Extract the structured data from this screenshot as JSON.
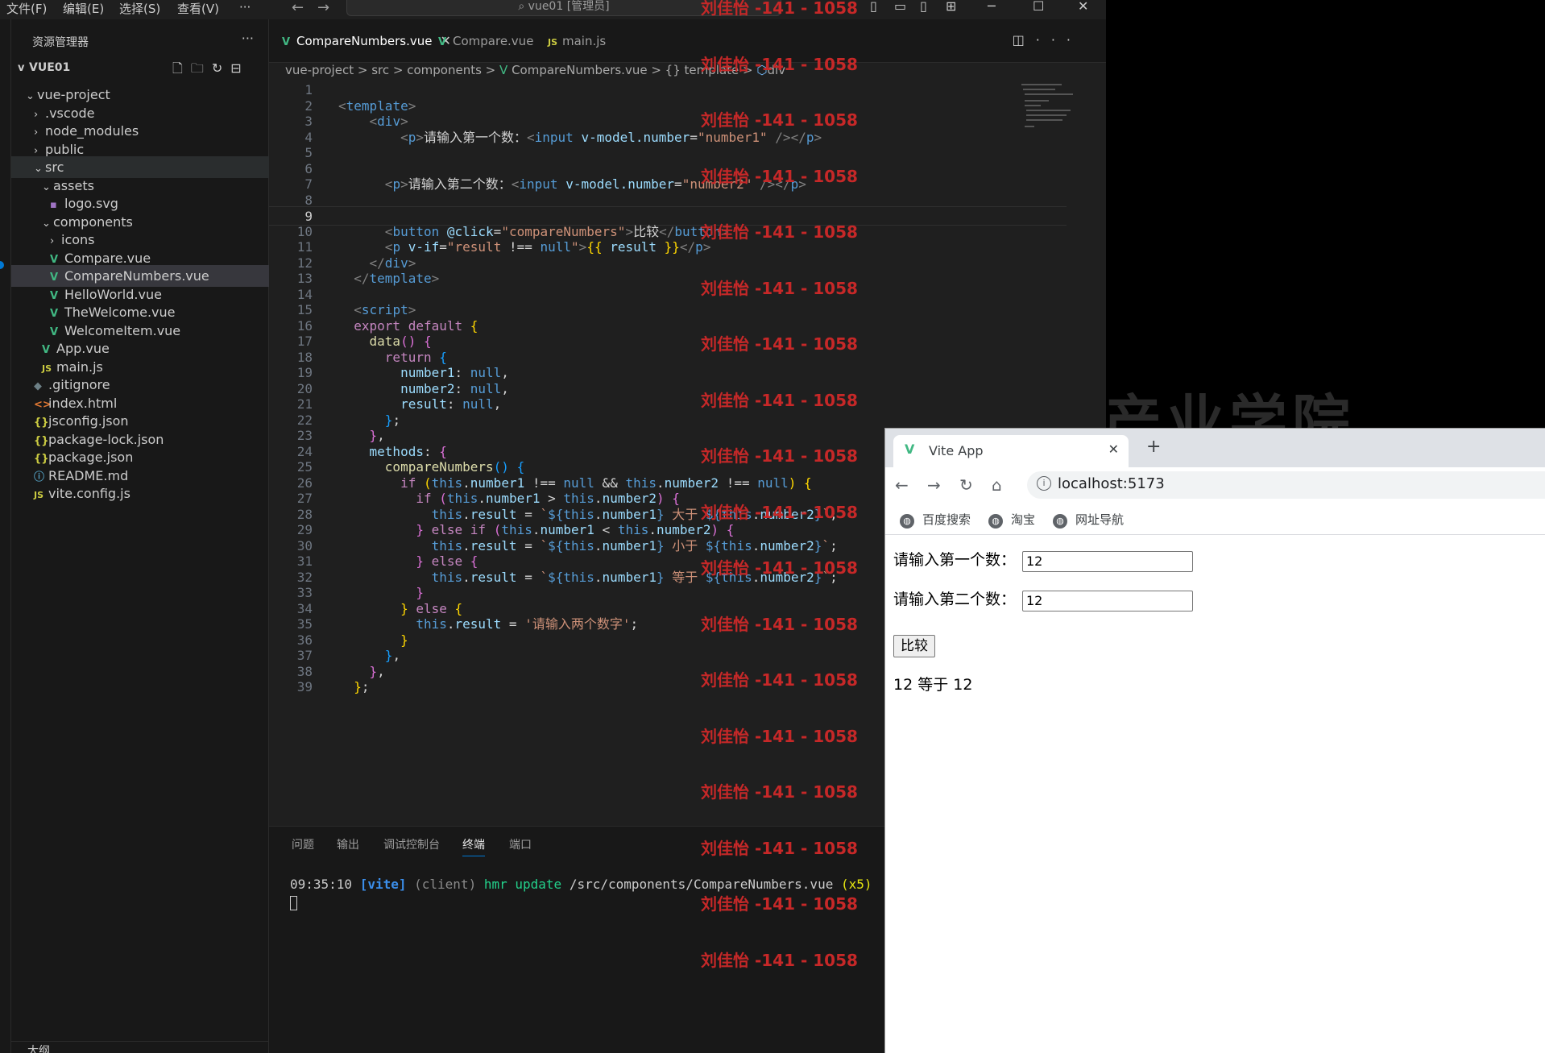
{
  "titlebar": {
    "menus": [
      "文件(F)",
      "编辑(E)",
      "选择(S)",
      "查看(V)",
      "···"
    ],
    "command_center": "vue01 [管理员]"
  },
  "sidebar": {
    "title": "资源管理器",
    "project": "VUE01",
    "bottom_label": "大纲",
    "tree": [
      {
        "label": "vue-project",
        "indent": 1,
        "chev": "v",
        "icon": ""
      },
      {
        "label": ".vscode",
        "indent": 2,
        "chev": ">",
        "icon": ""
      },
      {
        "label": "node_modules",
        "indent": 2,
        "chev": ">",
        "icon": ""
      },
      {
        "label": "public",
        "indent": 2,
        "chev": ">",
        "icon": ""
      },
      {
        "label": "src",
        "indent": 2,
        "chev": "v",
        "icon": "",
        "hover": true
      },
      {
        "label": "assets",
        "indent": 3,
        "chev": "v",
        "icon": ""
      },
      {
        "label": "logo.svg",
        "indent": 4,
        "chev": "",
        "icon": "svg"
      },
      {
        "label": "components",
        "indent": 3,
        "chev": "v",
        "icon": ""
      },
      {
        "label": "icons",
        "indent": 4,
        "chev": ">",
        "icon": ""
      },
      {
        "label": "Compare.vue",
        "indent": 4,
        "chev": "",
        "icon": "vue"
      },
      {
        "label": "CompareNumbers.vue",
        "indent": 4,
        "chev": "",
        "icon": "vue",
        "active": true
      },
      {
        "label": "HelloWorld.vue",
        "indent": 4,
        "chev": "",
        "icon": "vue"
      },
      {
        "label": "TheWelcome.vue",
        "indent": 4,
        "chev": "",
        "icon": "vue"
      },
      {
        "label": "WelcomeItem.vue",
        "indent": 4,
        "chev": "",
        "icon": "vue"
      },
      {
        "label": "App.vue",
        "indent": 3,
        "chev": "",
        "icon": "vue"
      },
      {
        "label": "main.js",
        "indent": 3,
        "chev": "",
        "icon": "js"
      },
      {
        "label": ".gitignore",
        "indent": 2,
        "chev": "",
        "icon": "git"
      },
      {
        "label": "index.html",
        "indent": 2,
        "chev": "",
        "icon": "html"
      },
      {
        "label": "jsconfig.json",
        "indent": 2,
        "chev": "",
        "icon": "json"
      },
      {
        "label": "package-lock.json",
        "indent": 2,
        "chev": "",
        "icon": "json"
      },
      {
        "label": "package.json",
        "indent": 2,
        "chev": "",
        "icon": "json"
      },
      {
        "label": "README.md",
        "indent": 2,
        "chev": "",
        "icon": "info"
      },
      {
        "label": "vite.config.js",
        "indent": 2,
        "chev": "",
        "icon": "js"
      }
    ]
  },
  "editor": {
    "tabs": [
      {
        "label": "CompareNumbers.vue",
        "icon": "vue",
        "active": true
      },
      {
        "label": "Compare.vue",
        "icon": "vue",
        "active": false
      },
      {
        "label": "main.js",
        "icon": "js",
        "active": false
      }
    ],
    "breadcrumb": [
      "vue-project",
      "src",
      "components",
      "CompareNumbers.vue",
      "{} template",
      "div"
    ],
    "current_line": 9,
    "lines": [
      [],
      [
        [
          "c-brk",
          "<"
        ],
        [
          "c-tag",
          "template"
        ],
        [
          "c-brk",
          ">"
        ]
      ],
      [
        [
          "c-txt",
          "    "
        ],
        [
          "c-brk",
          "<"
        ],
        [
          "c-tag",
          "div"
        ],
        [
          "c-brk",
          ">"
        ]
      ],
      [
        [
          "c-txt",
          "        "
        ],
        [
          "c-brk",
          "<"
        ],
        [
          "c-tag",
          "p"
        ],
        [
          "c-brk",
          ">"
        ],
        [
          "c-txt",
          "请输入第一个数："
        ],
        [
          "c-brk",
          "<"
        ],
        [
          "c-tag",
          "input"
        ],
        [
          "c-txt",
          " "
        ],
        [
          "c-attr",
          "v-model.number"
        ],
        [
          "c-txt",
          "="
        ],
        [
          "c-str",
          "\"number1\""
        ],
        [
          "c-txt",
          " "
        ],
        [
          "c-brk",
          "/></"
        ],
        [
          "c-tag",
          "p"
        ],
        [
          "c-brk",
          ">"
        ]
      ],
      [],
      [],
      [
        [
          "c-txt",
          "      "
        ],
        [
          "c-brk",
          "<"
        ],
        [
          "c-tag",
          "p"
        ],
        [
          "c-brk",
          ">"
        ],
        [
          "c-txt",
          "请输入第二个数："
        ],
        [
          "c-brk",
          "<"
        ],
        [
          "c-tag",
          "input"
        ],
        [
          "c-txt",
          " "
        ],
        [
          "c-attr",
          "v-model.number"
        ],
        [
          "c-txt",
          "="
        ],
        [
          "c-str",
          "\"number2\""
        ],
        [
          "c-txt",
          " "
        ],
        [
          "c-brk",
          "/></"
        ],
        [
          "c-tag",
          "p"
        ],
        [
          "c-brk",
          ">"
        ]
      ],
      [],
      [],
      [
        [
          "c-txt",
          "      "
        ],
        [
          "c-brk",
          "<"
        ],
        [
          "c-tag",
          "button"
        ],
        [
          "c-txt",
          " "
        ],
        [
          "c-attr",
          "@click"
        ],
        [
          "c-txt",
          "="
        ],
        [
          "c-str",
          "\"compareNumbers\""
        ],
        [
          "c-brk",
          ">"
        ],
        [
          "c-txt",
          "比较"
        ],
        [
          "c-brk",
          "</"
        ],
        [
          "c-tag",
          "button"
        ],
        [
          "c-brk",
          ">"
        ]
      ],
      [
        [
          "c-txt",
          "      "
        ],
        [
          "c-brk",
          "<"
        ],
        [
          "c-tag",
          "p"
        ],
        [
          "c-txt",
          " "
        ],
        [
          "c-attr",
          "v-if"
        ],
        [
          "c-txt",
          "="
        ],
        [
          "c-str",
          "\"result "
        ],
        [
          "c-txt",
          "!=="
        ],
        [
          "c-str",
          " "
        ],
        [
          "c-this",
          "null"
        ],
        [
          "c-str",
          "\""
        ],
        [
          "c-brk",
          ">"
        ],
        [
          "c-b1",
          "{{"
        ],
        [
          "c-var",
          " result "
        ],
        [
          "c-b1",
          "}}"
        ],
        [
          "c-brk",
          "</"
        ],
        [
          "c-tag",
          "p"
        ],
        [
          "c-brk",
          ">"
        ]
      ],
      [
        [
          "c-txt",
          "    "
        ],
        [
          "c-brk",
          "</"
        ],
        [
          "c-tag",
          "div"
        ],
        [
          "c-brk",
          ">"
        ]
      ],
      [
        [
          "c-txt",
          "  "
        ],
        [
          "c-brk",
          "</"
        ],
        [
          "c-tag",
          "template"
        ],
        [
          "c-brk",
          ">"
        ]
      ],
      [],
      [
        [
          "c-txt",
          "  "
        ],
        [
          "c-brk",
          "<"
        ],
        [
          "c-tag",
          "script"
        ],
        [
          "c-brk",
          ">"
        ]
      ],
      [
        [
          "c-txt",
          "  "
        ],
        [
          "c-kw",
          "export default"
        ],
        [
          "c-txt",
          " "
        ],
        [
          "c-b1",
          "{"
        ]
      ],
      [
        [
          "c-txt",
          "    "
        ],
        [
          "c-fn",
          "data"
        ],
        [
          "c-b2",
          "()"
        ],
        [
          "c-txt",
          " "
        ],
        [
          "c-b2",
          "{"
        ]
      ],
      [
        [
          "c-txt",
          "      "
        ],
        [
          "c-kw",
          "return"
        ],
        [
          "c-txt",
          " "
        ],
        [
          "c-b3",
          "{"
        ]
      ],
      [
        [
          "c-txt",
          "        "
        ],
        [
          "c-var",
          "number1"
        ],
        [
          "c-txt",
          ": "
        ],
        [
          "c-this",
          "null"
        ],
        [
          "c-txt",
          ","
        ]
      ],
      [
        [
          "c-txt",
          "        "
        ],
        [
          "c-var",
          "number2"
        ],
        [
          "c-txt",
          ": "
        ],
        [
          "c-this",
          "null"
        ],
        [
          "c-txt",
          ","
        ]
      ],
      [
        [
          "c-txt",
          "        "
        ],
        [
          "c-var",
          "result"
        ],
        [
          "c-txt",
          ": "
        ],
        [
          "c-this",
          "null"
        ],
        [
          "c-txt",
          ","
        ]
      ],
      [
        [
          "c-txt",
          "      "
        ],
        [
          "c-b3",
          "}"
        ],
        [
          "c-txt",
          ";"
        ]
      ],
      [
        [
          "c-txt",
          "    "
        ],
        [
          "c-b2",
          "}"
        ],
        [
          "c-txt",
          ","
        ]
      ],
      [
        [
          "c-txt",
          "    "
        ],
        [
          "c-var",
          "methods"
        ],
        [
          "c-txt",
          ": "
        ],
        [
          "c-b2",
          "{"
        ]
      ],
      [
        [
          "c-txt",
          "      "
        ],
        [
          "c-fn",
          "compareNumbers"
        ],
        [
          "c-b3",
          "()"
        ],
        [
          "c-txt",
          " "
        ],
        [
          "c-b3",
          "{"
        ]
      ],
      [
        [
          "c-txt",
          "        "
        ],
        [
          "c-kw",
          "if"
        ],
        [
          "c-txt",
          " "
        ],
        [
          "c-b1",
          "("
        ],
        [
          "c-this",
          "this"
        ],
        [
          "c-txt",
          "."
        ],
        [
          "c-var",
          "number1"
        ],
        [
          "c-txt",
          " !== "
        ],
        [
          "c-this",
          "null"
        ],
        [
          "c-txt",
          " && "
        ],
        [
          "c-this",
          "this"
        ],
        [
          "c-txt",
          "."
        ],
        [
          "c-var",
          "number2"
        ],
        [
          "c-txt",
          " !== "
        ],
        [
          "c-this",
          "null"
        ],
        [
          "c-b1",
          ")"
        ],
        [
          "c-txt",
          " "
        ],
        [
          "c-b1",
          "{"
        ]
      ],
      [
        [
          "c-txt",
          "          "
        ],
        [
          "c-kw",
          "if"
        ],
        [
          "c-txt",
          " "
        ],
        [
          "c-b2",
          "("
        ],
        [
          "c-this",
          "this"
        ],
        [
          "c-txt",
          "."
        ],
        [
          "c-var",
          "number1"
        ],
        [
          "c-txt",
          " > "
        ],
        [
          "c-this",
          "this"
        ],
        [
          "c-txt",
          "."
        ],
        [
          "c-var",
          "number2"
        ],
        [
          "c-b2",
          ")"
        ],
        [
          "c-txt",
          " "
        ],
        [
          "c-b2",
          "{"
        ]
      ],
      [
        [
          "c-txt",
          "            "
        ],
        [
          "c-this",
          "this"
        ],
        [
          "c-txt",
          "."
        ],
        [
          "c-var",
          "result"
        ],
        [
          "c-txt",
          " = "
        ],
        [
          "c-str",
          "`"
        ],
        [
          "c-this",
          "${"
        ],
        [
          "c-this",
          "this"
        ],
        [
          "c-txt",
          "."
        ],
        [
          "c-var",
          "number1"
        ],
        [
          "c-this",
          "}"
        ],
        [
          "c-str",
          " 大于 "
        ],
        [
          "c-this",
          "${"
        ],
        [
          "c-this",
          "this"
        ],
        [
          "c-txt",
          "."
        ],
        [
          "c-var",
          "number2"
        ],
        [
          "c-this",
          "}"
        ],
        [
          "c-str",
          "`"
        ],
        [
          "c-txt",
          ";"
        ]
      ],
      [
        [
          "c-txt",
          "          "
        ],
        [
          "c-b2",
          "}"
        ],
        [
          "c-txt",
          " "
        ],
        [
          "c-kw",
          "else if"
        ],
        [
          "c-txt",
          " "
        ],
        [
          "c-b2",
          "("
        ],
        [
          "c-this",
          "this"
        ],
        [
          "c-txt",
          "."
        ],
        [
          "c-var",
          "number1"
        ],
        [
          "c-txt",
          " < "
        ],
        [
          "c-this",
          "this"
        ],
        [
          "c-txt",
          "."
        ],
        [
          "c-var",
          "number2"
        ],
        [
          "c-b2",
          ")"
        ],
        [
          "c-txt",
          " "
        ],
        [
          "c-b2",
          "{"
        ]
      ],
      [
        [
          "c-txt",
          "            "
        ],
        [
          "c-this",
          "this"
        ],
        [
          "c-txt",
          "."
        ],
        [
          "c-var",
          "result"
        ],
        [
          "c-txt",
          " = "
        ],
        [
          "c-str",
          "`"
        ],
        [
          "c-this",
          "${"
        ],
        [
          "c-this",
          "this"
        ],
        [
          "c-txt",
          "."
        ],
        [
          "c-var",
          "number1"
        ],
        [
          "c-this",
          "}"
        ],
        [
          "c-str",
          " 小于 "
        ],
        [
          "c-this",
          "${"
        ],
        [
          "c-this",
          "this"
        ],
        [
          "c-txt",
          "."
        ],
        [
          "c-var",
          "number2"
        ],
        [
          "c-this",
          "}"
        ],
        [
          "c-str",
          "`"
        ],
        [
          "c-txt",
          ";"
        ]
      ],
      [
        [
          "c-txt",
          "          "
        ],
        [
          "c-b2",
          "}"
        ],
        [
          "c-txt",
          " "
        ],
        [
          "c-kw",
          "else"
        ],
        [
          "c-txt",
          " "
        ],
        [
          "c-b2",
          "{"
        ]
      ],
      [
        [
          "c-txt",
          "            "
        ],
        [
          "c-this",
          "this"
        ],
        [
          "c-txt",
          "."
        ],
        [
          "c-var",
          "result"
        ],
        [
          "c-txt",
          " = "
        ],
        [
          "c-str",
          "`"
        ],
        [
          "c-this",
          "${"
        ],
        [
          "c-this",
          "this"
        ],
        [
          "c-txt",
          "."
        ],
        [
          "c-var",
          "number1"
        ],
        [
          "c-this",
          "}"
        ],
        [
          "c-str",
          " 等于 "
        ],
        [
          "c-this",
          "${"
        ],
        [
          "c-this",
          "this"
        ],
        [
          "c-txt",
          "."
        ],
        [
          "c-var",
          "number2"
        ],
        [
          "c-this",
          "}"
        ],
        [
          "c-str",
          "`"
        ],
        [
          "c-txt",
          ";"
        ]
      ],
      [
        [
          "c-txt",
          "          "
        ],
        [
          "c-b2",
          "}"
        ]
      ],
      [
        [
          "c-txt",
          "        "
        ],
        [
          "c-b1",
          "}"
        ],
        [
          "c-txt",
          " "
        ],
        [
          "c-kw",
          "else"
        ],
        [
          "c-txt",
          " "
        ],
        [
          "c-b1",
          "{"
        ]
      ],
      [
        [
          "c-txt",
          "          "
        ],
        [
          "c-this",
          "this"
        ],
        [
          "c-txt",
          "."
        ],
        [
          "c-var",
          "result"
        ],
        [
          "c-txt",
          " = "
        ],
        [
          "c-str",
          "'请输入两个数字'"
        ],
        [
          "c-txt",
          ";"
        ]
      ],
      [
        [
          "c-txt",
          "        "
        ],
        [
          "c-b1",
          "}"
        ]
      ],
      [
        [
          "c-txt",
          "      "
        ],
        [
          "c-b3",
          "}"
        ],
        [
          "c-txt",
          ","
        ]
      ],
      [
        [
          "c-txt",
          "    "
        ],
        [
          "c-b2",
          "}"
        ],
        [
          "c-txt",
          ","
        ]
      ],
      [
        [
          "c-txt",
          "  "
        ],
        [
          "c-b1",
          "}"
        ],
        [
          "c-txt",
          ";"
        ]
      ]
    ]
  },
  "panel": {
    "tabs": [
      {
        "label": "问题",
        "active": false
      },
      {
        "label": "输出",
        "active": false
      },
      {
        "label": "调试控制台",
        "active": false
      },
      {
        "label": "终端",
        "active": true
      },
      {
        "label": "端口",
        "active": false
      }
    ],
    "terminal": {
      "time": "09:35:10",
      "tag": "[vite]",
      "client": "(client)",
      "hmr": "hmr update",
      "path": "/src/components/CompareNumbers.vue",
      "count": "(x5)"
    }
  },
  "watermark": {
    "text": "刘佳怡 -141 - 1058",
    "background_text": "产业学院"
  },
  "browser": {
    "tab_title": "Vite App",
    "url": "localhost:5173",
    "bookmarks": [
      "百度搜索",
      "淘宝",
      "网址导航"
    ],
    "page": {
      "label1": "请输入第一个数：",
      "value1": "12",
      "label2": "请输入第二个数：",
      "value2": "12",
      "button": "比较",
      "result": "12 等于 12"
    }
  },
  "colors": {
    "editor_bg": "#1f1f1f",
    "sidebar_bg": "#181818",
    "accent": "#0078d4",
    "watermark": "#c62828",
    "vue_green": "#41b883"
  }
}
